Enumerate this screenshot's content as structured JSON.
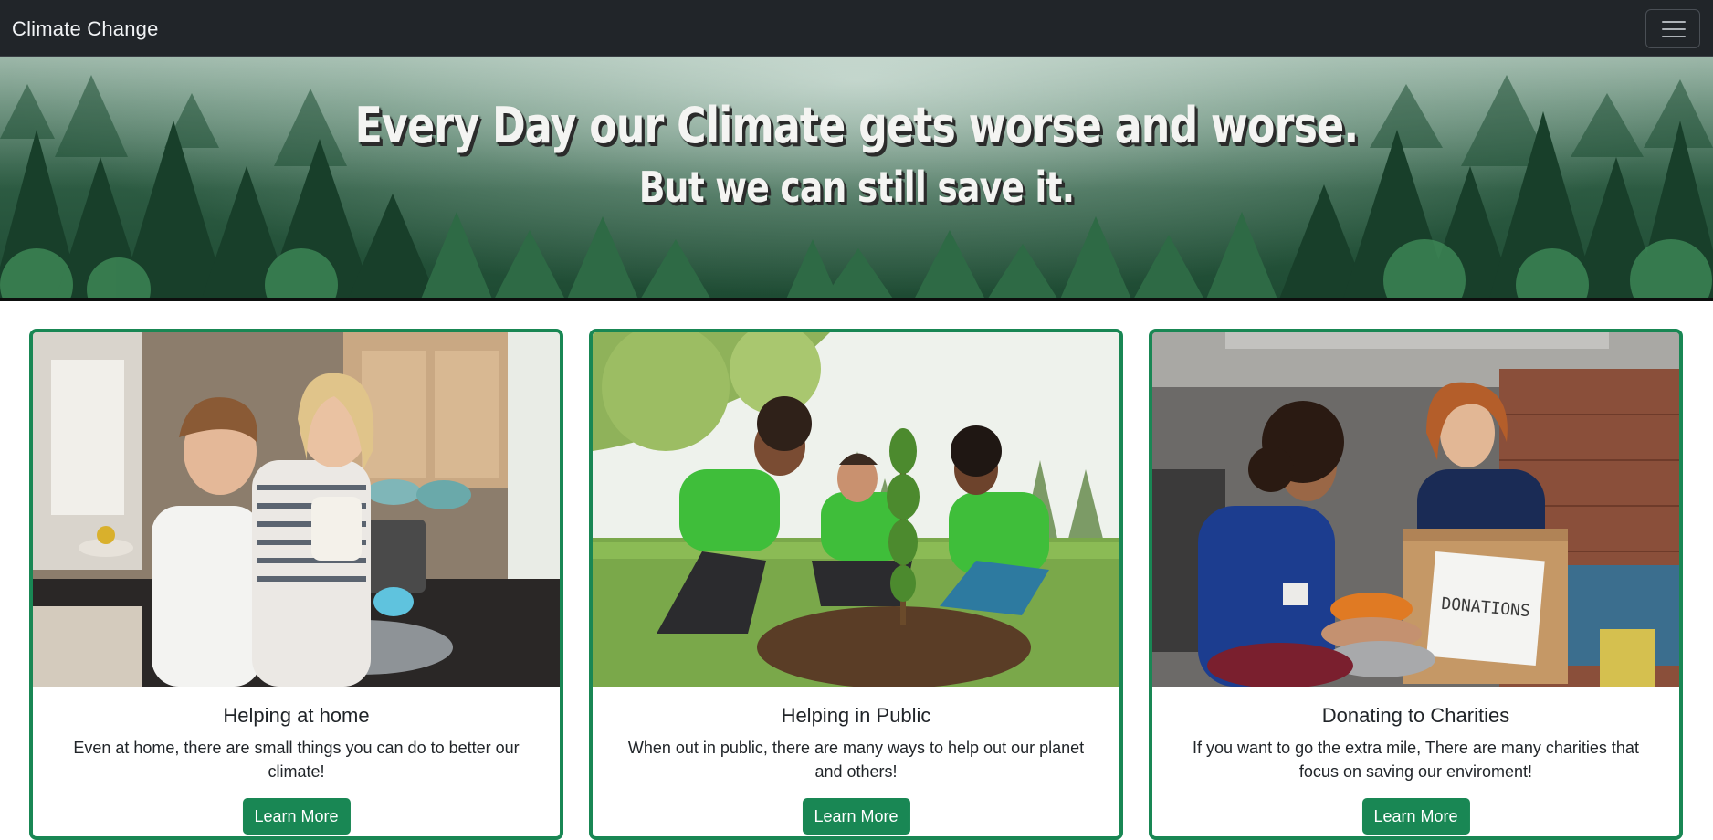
{
  "navbar": {
    "brand": "Climate Change",
    "toggle_icon": "hamburger-menu-icon"
  },
  "hero": {
    "headline": "Every Day our Climate gets worse and worse.",
    "subheadline": "But we can still save it."
  },
  "cards": [
    {
      "title": "Helping at home",
      "text": "Even at home, there are small things you can do to better our climate!",
      "button": "Learn More"
    },
    {
      "title": "Helping in Public",
      "text": "When out in public, there are many ways to help out our planet and others!",
      "button": "Learn More"
    },
    {
      "title": "Donating to Charities",
      "text": "If you want to go the extra mile, There are many charities that focus on saving our enviroment!",
      "button": "Learn More",
      "box_label": "DONATIONS"
    }
  ],
  "colors": {
    "navbar_bg": "#212529",
    "accent_green": "#198754"
  }
}
